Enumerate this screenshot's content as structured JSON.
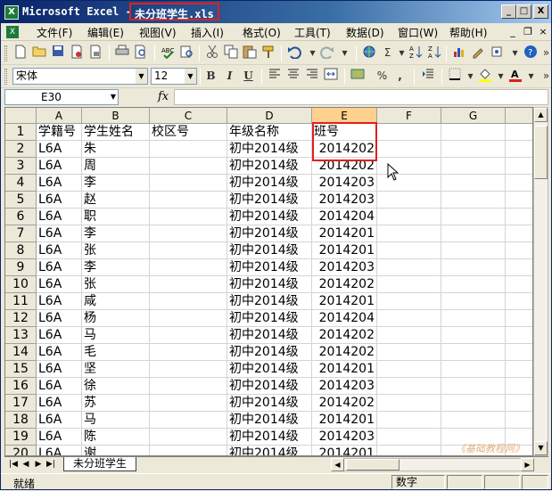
{
  "window": {
    "app_title": "Microsoft Excel - ",
    "file_name": "未分班学生.xls",
    "buttons": {
      "minimize": "_",
      "restore": "□",
      "close": "X"
    }
  },
  "menu": {
    "items": [
      "文件(F)",
      "编辑(E)",
      "视图(V)",
      "插入(I)",
      "格式(O)",
      "工具(T)",
      "数据(D)",
      "窗口(W)",
      "帮助(H)"
    ],
    "mdi": {
      "minimize": "_",
      "restore": "❐",
      "close": "×"
    }
  },
  "toolbar": {
    "font_name": "宋体",
    "font_size": "12",
    "bold": "B",
    "italic": "I",
    "underline": "U",
    "percent": "%",
    "comma": ",",
    "sigma": "Σ"
  },
  "formula_bar": {
    "name_box": "E30",
    "fx": "fx",
    "formula": ""
  },
  "grid": {
    "columns": [
      "A",
      "B",
      "C",
      "D",
      "E",
      "F",
      "G"
    ],
    "selected_column": "E",
    "rows": [
      {
        "n": "1",
        "a": "学籍号",
        "b": "学生姓名",
        "c": "校区号",
        "d": "年级名称",
        "e": "班号"
      },
      {
        "n": "2",
        "a": "L6A",
        "b": "朱",
        "c": "",
        "d": "初中2014级",
        "e": "2014202"
      },
      {
        "n": "3",
        "a": "L6A",
        "b": "周",
        "c": "",
        "d": "初中2014级",
        "e": "2014202"
      },
      {
        "n": "4",
        "a": "L6A",
        "b": "李",
        "c": "",
        "d": "初中2014级",
        "e": "2014203"
      },
      {
        "n": "5",
        "a": "L6A",
        "b": "赵",
        "c": "",
        "d": "初中2014级",
        "e": "2014203"
      },
      {
        "n": "6",
        "a": "L6A",
        "b": "职",
        "c": "",
        "d": "初中2014级",
        "e": "2014204"
      },
      {
        "n": "7",
        "a": "L6A",
        "b": "李",
        "c": "",
        "d": "初中2014级",
        "e": "2014201"
      },
      {
        "n": "8",
        "a": "L6A",
        "b": "张",
        "c": "",
        "d": "初中2014级",
        "e": "2014201"
      },
      {
        "n": "9",
        "a": "L6A",
        "b": "李",
        "c": "",
        "d": "初中2014级",
        "e": "2014203"
      },
      {
        "n": "10",
        "a": "L6A",
        "b": "张",
        "c": "",
        "d": "初中2014级",
        "e": "2014202"
      },
      {
        "n": "11",
        "a": "L6A",
        "b": "咸",
        "c": "",
        "d": "初中2014级",
        "e": "2014201"
      },
      {
        "n": "12",
        "a": "L6A",
        "b": "杨",
        "c": "",
        "d": "初中2014级",
        "e": "2014204"
      },
      {
        "n": "13",
        "a": "L6A",
        "b": "马",
        "c": "",
        "d": "初中2014级",
        "e": "2014202"
      },
      {
        "n": "14",
        "a": "L6A",
        "b": "毛",
        "c": "",
        "d": "初中2014级",
        "e": "2014202"
      },
      {
        "n": "15",
        "a": "L6A",
        "b": "坚",
        "c": "",
        "d": "初中2014级",
        "e": "2014201"
      },
      {
        "n": "16",
        "a": "L6A",
        "b": "徐",
        "c": "",
        "d": "初中2014级",
        "e": "2014203"
      },
      {
        "n": "17",
        "a": "L6A",
        "b": "苏",
        "c": "",
        "d": "初中2014级",
        "e": "2014202"
      },
      {
        "n": "18",
        "a": "L6A",
        "b": "马",
        "c": "",
        "d": "初中2014级",
        "e": "2014201"
      },
      {
        "n": "19",
        "a": "L6A",
        "b": "陈",
        "c": "",
        "d": "初中2014级",
        "e": "2014203"
      },
      {
        "n": "20",
        "a": "L6A",
        "b": "谢",
        "c": "",
        "d": "初中2014级",
        "e": "2014201"
      }
    ]
  },
  "sheet_tabs": {
    "active": "未分班学生"
  },
  "watermark": "《基础教程网》",
  "status": {
    "ready": "就绪",
    "num_lock": "数字"
  },
  "icons": {
    "toolbar1": [
      "new-icon",
      "open-icon",
      "save-icon",
      "permission-icon",
      "print-icon",
      "print-preview-icon",
      "spelling-icon",
      "research-icon",
      "cut-icon",
      "copy-icon",
      "paste-icon",
      "format-painter-icon",
      "undo-icon",
      "redo-icon",
      "hyperlink-icon",
      "autosum-icon",
      "sort-ascending-icon",
      "sort-descending-icon",
      "chart-wizard-icon",
      "drawing-icon",
      "zoom-icon",
      "help-icon"
    ],
    "toolbar2": [
      "bold-icon",
      "italic-icon",
      "underline-icon",
      "align-left-icon",
      "align-center-icon",
      "align-right-icon",
      "merge-center-icon",
      "currency-icon",
      "percent-icon",
      "comma-icon",
      "indent-icon",
      "borders-icon",
      "fill-color-icon",
      "font-color-icon"
    ]
  }
}
